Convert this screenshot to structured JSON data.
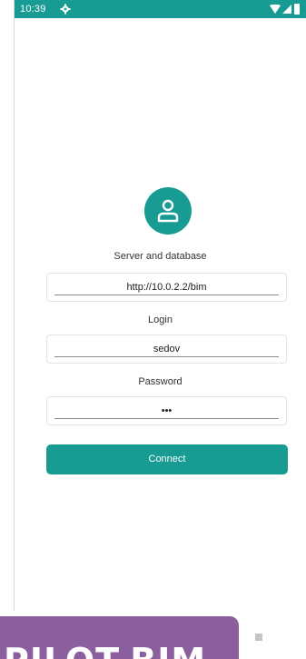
{
  "status_bar": {
    "time": "10:39",
    "icons": [
      "gear-icon",
      "wifi-icon",
      "signal-icon",
      "battery-icon"
    ]
  },
  "colors": {
    "accent": "#179b93",
    "brand": "#8b5f9d"
  },
  "form": {
    "avatar_icon": "user-icon",
    "server_label": "Server and database",
    "server_value": "http://10.0.2.2/bim",
    "login_label": "Login",
    "login_value": "sedov",
    "password_label": "Password",
    "password_value": "•••",
    "connect_label": "Connect"
  },
  "brand": {
    "name": "PILOT-BIM"
  }
}
